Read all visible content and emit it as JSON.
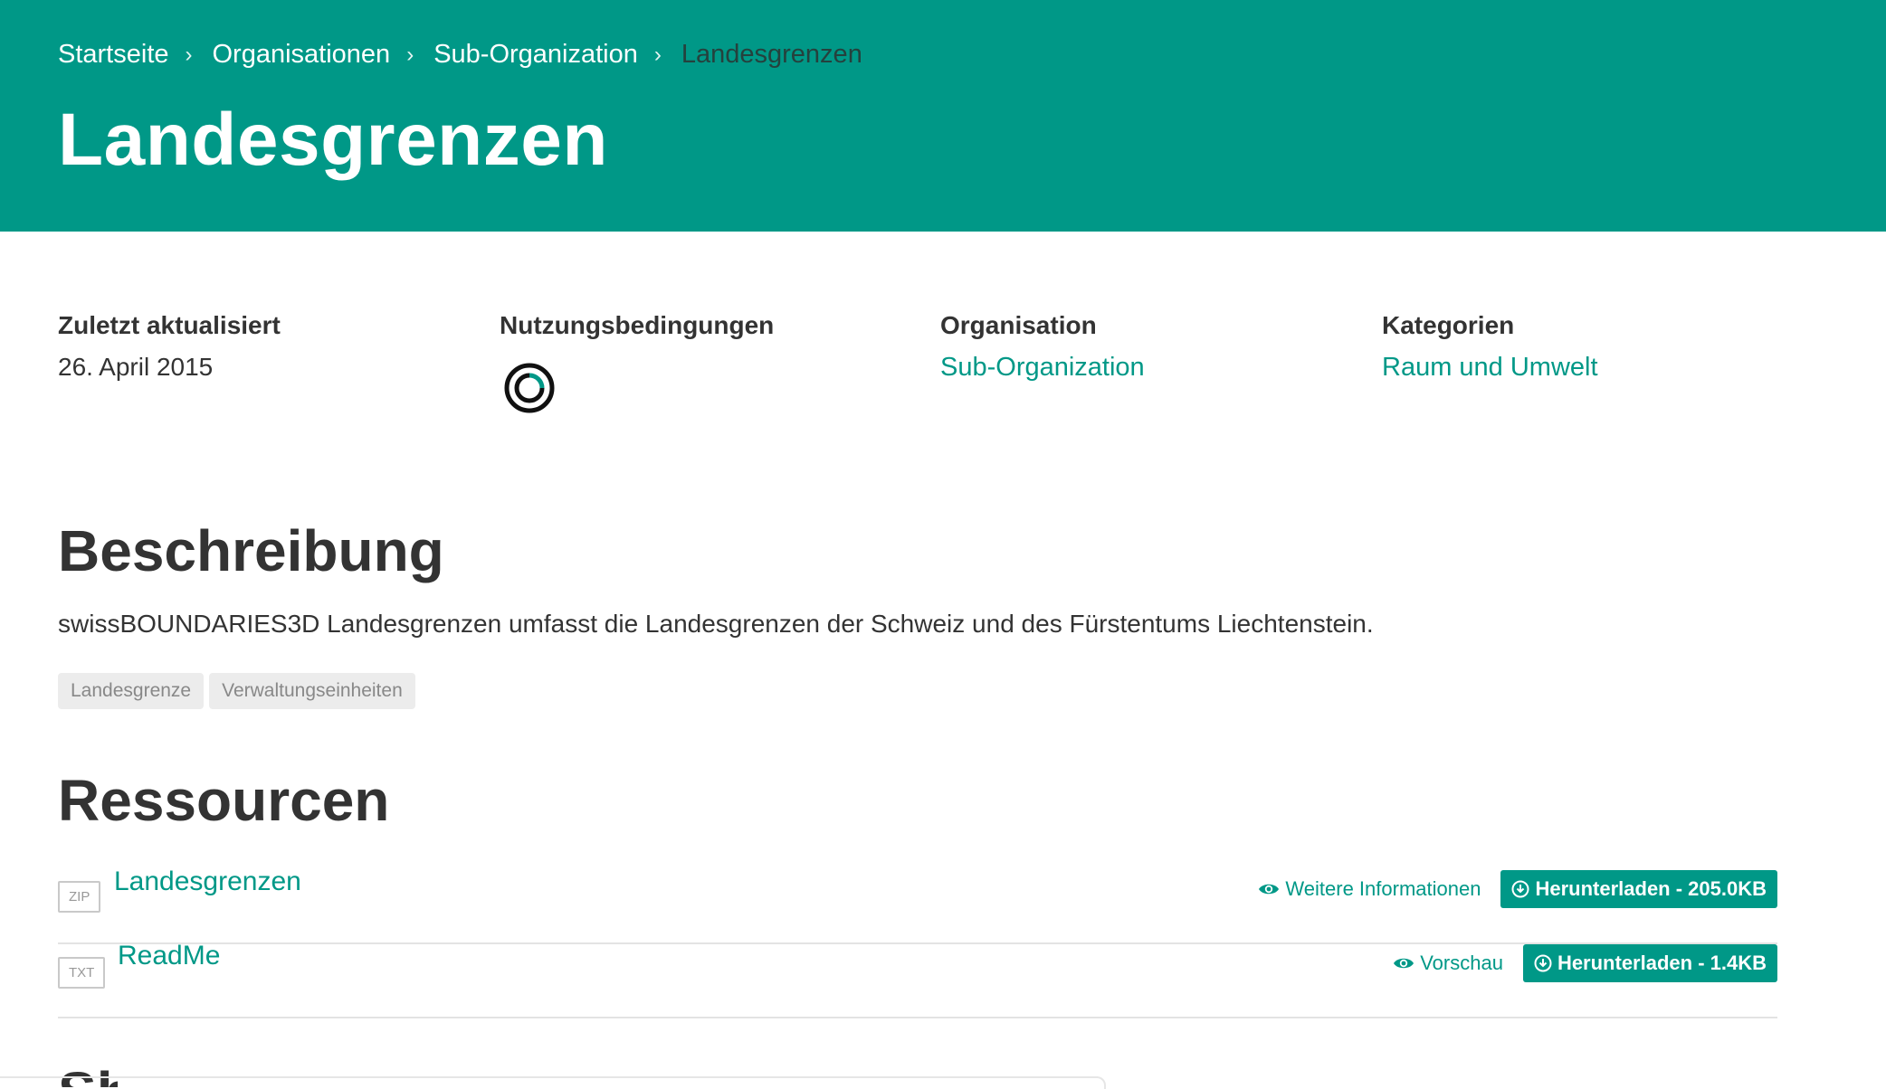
{
  "breadcrumb": {
    "items": [
      "Startseite",
      "Organisationen",
      "Sub-Organization"
    ],
    "current": "Landesgrenzen",
    "separator": "›"
  },
  "header": {
    "title": "Landesgrenzen"
  },
  "meta": {
    "updated": {
      "label": "Zuletzt aktualisiert",
      "value": "26. April 2015"
    },
    "terms": {
      "label": "Nutzungsbedingungen",
      "icon": "license-icon"
    },
    "organization": {
      "label": "Organisation",
      "value": "Sub-Organization"
    },
    "categories": {
      "label": "Kategorien",
      "value": "Raum und Umwelt"
    }
  },
  "description": {
    "title": "Beschreibung",
    "text": "swissBOUNDARIES3D Landesgrenzen umfasst die Landesgrenzen der Schweiz und des Fürstentums Liechtenstein.",
    "tags": [
      "Landesgrenze",
      "Verwaltungseinheiten"
    ]
  },
  "resources": {
    "title": "Ressourcen",
    "items": [
      {
        "format": "ZIP",
        "name": "Landesgrenzen",
        "info_label": "Weitere Informationen",
        "download_label": "Herunterladen - 205.0KB"
      },
      {
        "format": "TXT",
        "name": "ReadMe",
        "info_label": "Vorschau",
        "download_label": "Herunterladen - 1.4KB"
      }
    ]
  },
  "next_section": {
    "peek": "Sh"
  },
  "colors": {
    "accent": "#009887",
    "breadcrumb_current": "#25413d",
    "text": "#333333",
    "tag_bg": "#ececec"
  }
}
